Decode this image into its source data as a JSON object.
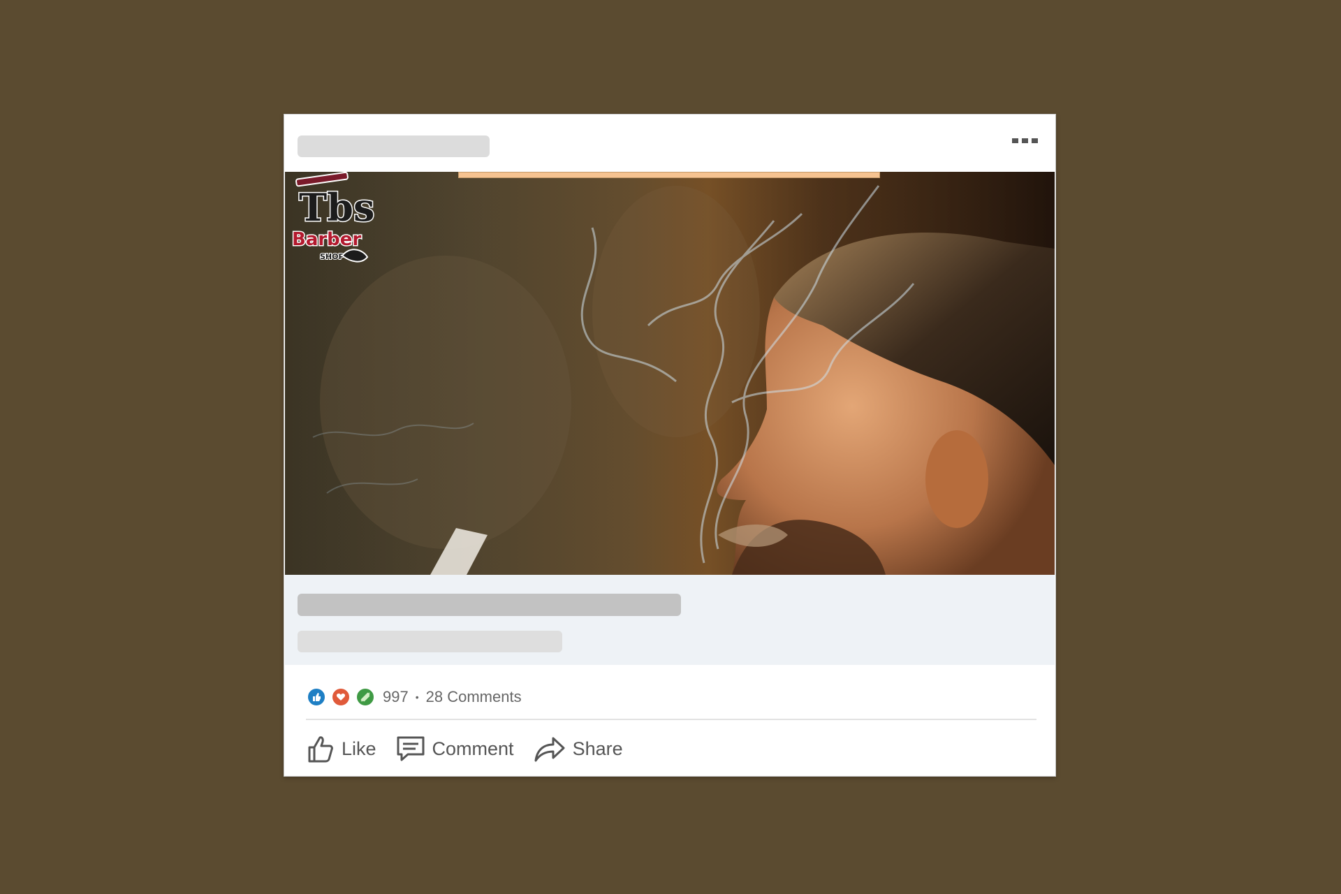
{
  "post": {
    "reactions": {
      "icons": [
        "like-icon",
        "love-icon",
        "celebrate-icon"
      ],
      "count": "997",
      "separator": "•",
      "comments": "28 Comments"
    },
    "actions": {
      "like_label": "Like",
      "comment_label": "Comment",
      "share_label": "Share"
    }
  },
  "colors": {
    "page_background": "#5b4b30",
    "card_background": "#ffffff",
    "skeleton_dark": "#c2c2c2",
    "skeleton_light": "#dcdcdc",
    "accent_like": "#1e7fc4",
    "accent_love": "#e05a3a",
    "accent_celebrate": "#3f9a44"
  }
}
